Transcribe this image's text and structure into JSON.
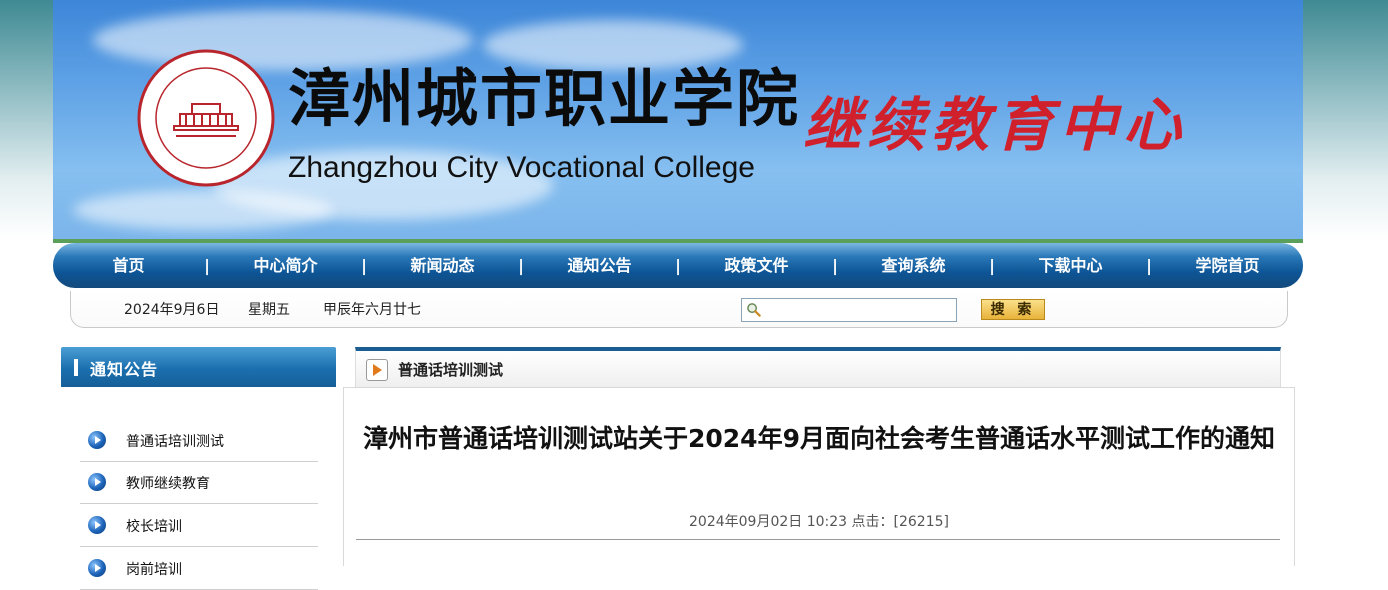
{
  "header": {
    "title_cn": "漳州城市职业学院",
    "title_en": "Zhangzhou City Vocational College",
    "subtitle_red": "继续教育中心",
    "seal_text_cn": "漳州城市职业学院",
    "seal_text_en": "Zhangzhou City Vocational College"
  },
  "nav": {
    "items": [
      "首页",
      "中心简介",
      "新闻动态",
      "通知公告",
      "政策文件",
      "查询系统",
      "下载中心",
      "学院首页"
    ],
    "separator": "|"
  },
  "datebar": {
    "date": "2024年9月6日",
    "weekday": "星期五",
    "lunar": "甲辰年六月廿七",
    "search_value": "",
    "search_button": "搜 索"
  },
  "sidebar": {
    "title": "通知公告",
    "items": [
      "普通话培训测试",
      "教师继续教育",
      "校长培训",
      "岗前培训"
    ]
  },
  "content": {
    "section_title": "普通话培训测试",
    "article_title": "漳州市普通话培训测试站关于2024年9月面向社会考生普通话水平测试工作的通知",
    "article_meta": "2024年09月02日 10:23  点击：[26215]"
  },
  "colors": {
    "nav_blue": "#0d5596",
    "accent_red": "#d0202b",
    "button_gold": "#e8b23a"
  },
  "icons": {
    "search": "search-icon",
    "bullet": "bullet-arrow-icon",
    "section": "arrow-doc-icon"
  }
}
